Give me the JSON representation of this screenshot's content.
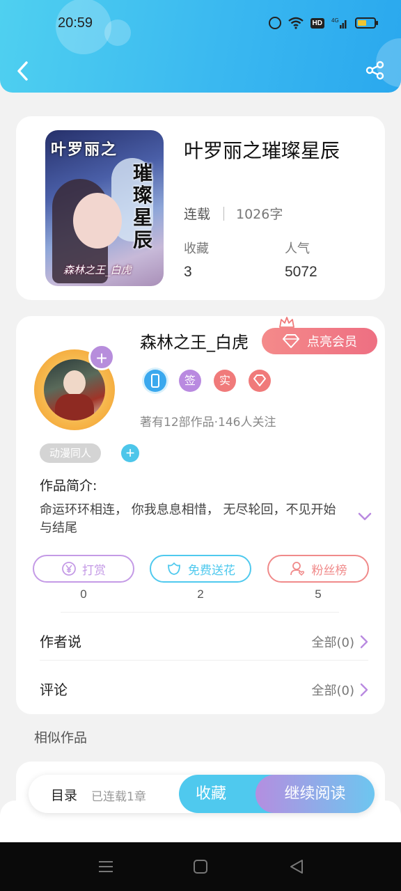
{
  "status_bar": {
    "time": "20:59",
    "network": "4G"
  },
  "header": {
    "back_icon": "chevron-left-icon",
    "share_icon": "share-icon"
  },
  "book": {
    "title": "叶罗丽之璀璨星辰",
    "status": "连载",
    "word_count": "1026字",
    "favorites_label": "收藏",
    "favorites_value": "3",
    "popularity_label": "人气",
    "popularity_value": "5072",
    "cover": {
      "title_horizontal": "叶罗丽之",
      "title_vertical": "璀璨星辰",
      "author_signature": "森林之王_白虎"
    }
  },
  "author": {
    "name": "森林之王_白虎",
    "vip_label": "点亮会员",
    "badges": [
      {
        "text": "",
        "color": "#3aa8ee",
        "icon": "phone-icon"
      },
      {
        "text": "签",
        "color": "#b98ae0"
      },
      {
        "text": "实",
        "color": "#f07a7a"
      },
      {
        "text": "",
        "color": "#f07a7a",
        "icon": "diamond-icon"
      }
    ],
    "works_info": "著有12部作品·146人关注",
    "tag": "动漫同人",
    "intro_label": "作品简介:",
    "intro_text": "命运环环相连， 你我息息相惜， 无尽轮回，不见开始与结尾"
  },
  "actions": [
    {
      "label": "打赏",
      "count": "0",
      "color": "#c49ae6",
      "icon": "yen-coin-icon"
    },
    {
      "label": "免费送花",
      "count": "2",
      "color": "#4fc9ee",
      "icon": "flower-icon"
    },
    {
      "label": "粉丝榜",
      "count": "5",
      "color": "#f08a8a",
      "icon": "fan-user-icon"
    }
  ],
  "rows": {
    "author_says_label": "作者说",
    "author_says_right": "全部(0)",
    "comments_label": "评论",
    "comments_right": "全部(0)"
  },
  "similar": {
    "title": "相似作品"
  },
  "bottom_bar": {
    "toc_label": "目录",
    "toc_sub": "已连载1章",
    "collect_label": "收藏",
    "read_label": "继续阅读"
  }
}
